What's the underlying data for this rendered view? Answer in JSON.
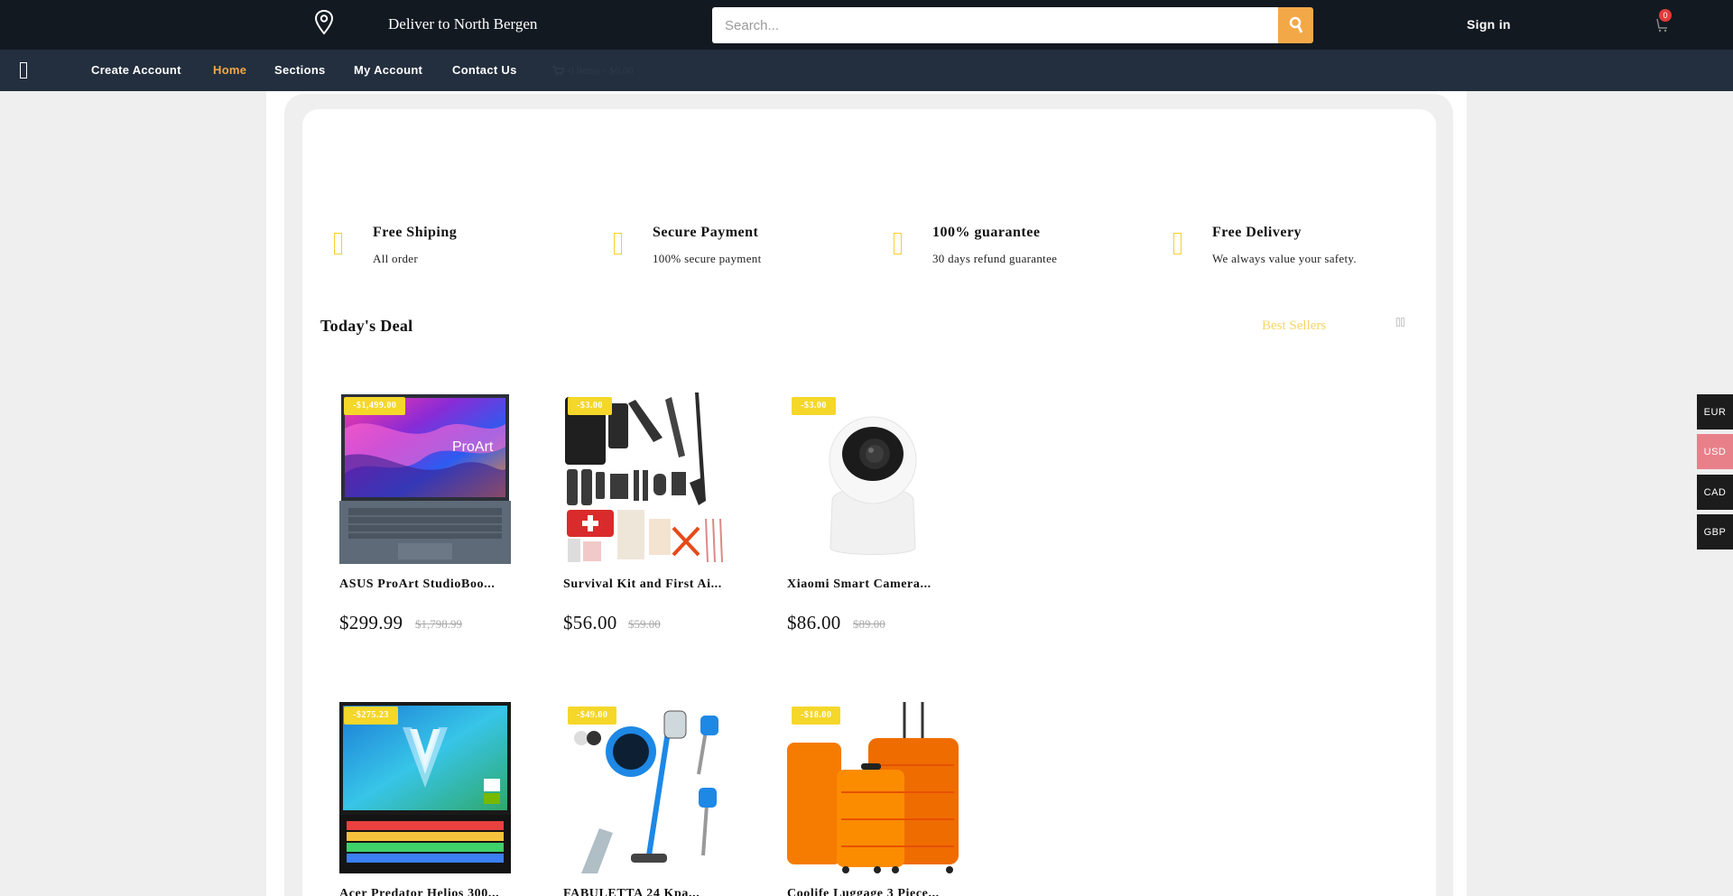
{
  "header": {
    "deliver_to": "Deliver to North Bergen",
    "search_placeholder": "Search...",
    "sign_in": "Sign in",
    "cart_count": "0",
    "accent_color": "#f3a847"
  },
  "nav": {
    "items": [
      {
        "label": "Create Account"
      },
      {
        "label": "Home",
        "active": true
      },
      {
        "label": "Sections"
      },
      {
        "label": "My Account"
      },
      {
        "label": "Contact Us"
      }
    ],
    "cart_summary": "0 items - $0.00"
  },
  "features": [
    {
      "title": "Free Shiping",
      "subtitle": "All order"
    },
    {
      "title": "Secure Payment",
      "subtitle": "100% secure payment"
    },
    {
      "title": "100% guarantee",
      "subtitle": "30 days refund guarantee"
    },
    {
      "title": "Free Delivery",
      "subtitle": "We always value your safety."
    }
  ],
  "deals": {
    "title": "Today's Deal",
    "tab": "Best Sellers",
    "products": [
      {
        "badge": "-$1,499.00",
        "name": "ASUS ProArt StudioBoo...",
        "price": "$299.99",
        "old_price": "$1,798.99",
        "image": "laptop-proart"
      },
      {
        "badge": "-$3.00",
        "name": "Survival Kit and First Ai...",
        "price": "$56.00",
        "old_price": "$59.00",
        "image": "survival-kit"
      },
      {
        "badge": "-$3.00",
        "name": "Xiaomi Smart Camera...",
        "price": "$86.00",
        "old_price": "$89.00",
        "image": "security-camera"
      },
      {
        "badge": "-$275.23",
        "name": "Acer Predator Helios 300...",
        "price": "",
        "old_price": "",
        "image": "laptop-predator"
      },
      {
        "badge": "-$49.00",
        "name": "FABULETTA 24 Kpa...",
        "price": "",
        "old_price": "",
        "image": "stick-vacuum"
      },
      {
        "badge": "-$18.00",
        "name": "Coolife Luggage 3 Piece...",
        "price": "",
        "old_price": "",
        "image": "luggage-set"
      }
    ]
  },
  "currencies": [
    {
      "code": "EUR"
    },
    {
      "code": "USD",
      "active": true
    },
    {
      "code": "CAD"
    },
    {
      "code": "GBP"
    }
  ]
}
